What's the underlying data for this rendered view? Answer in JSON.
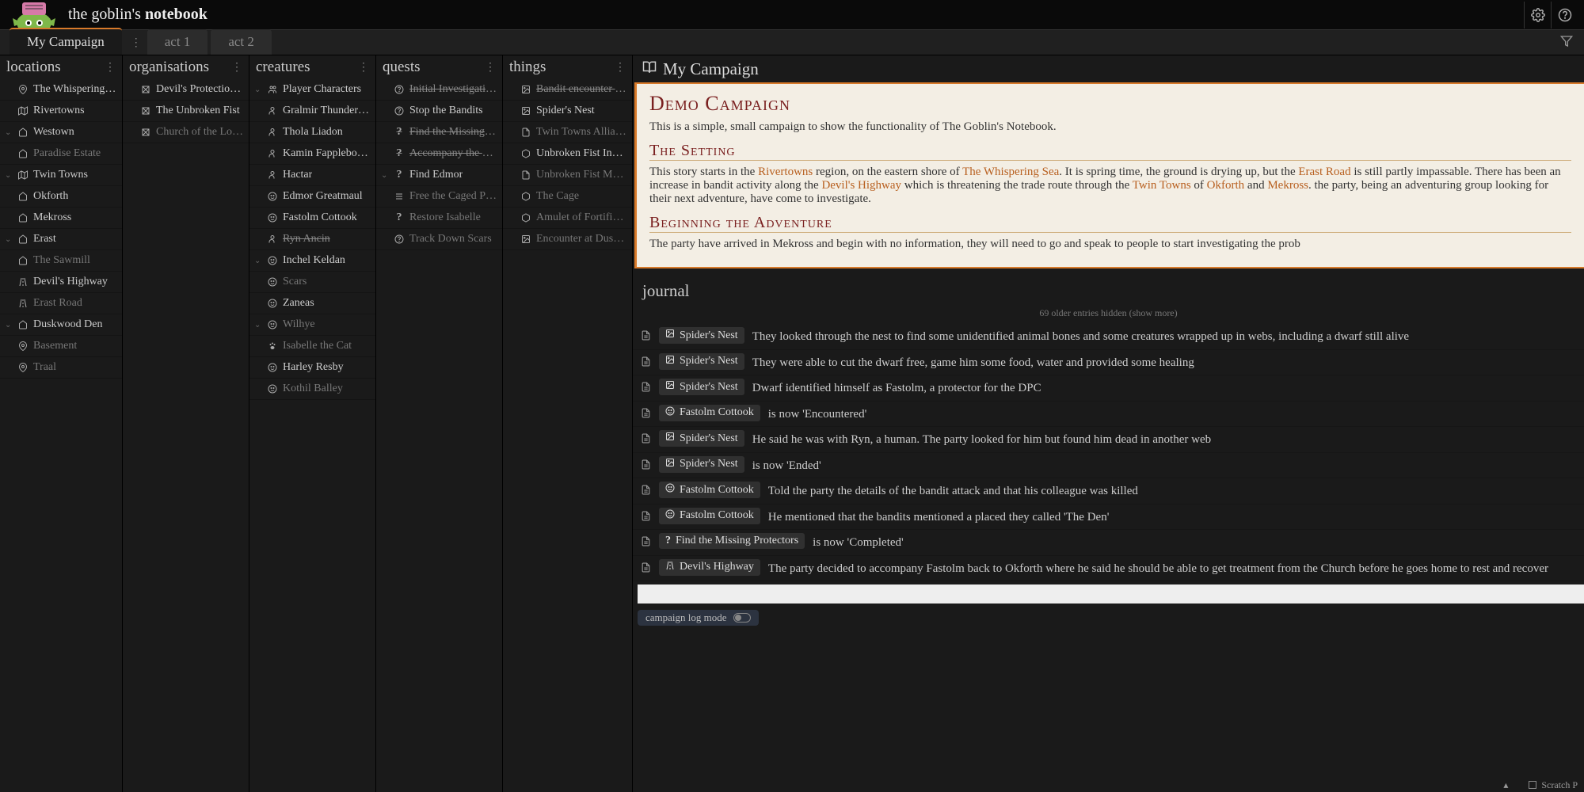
{
  "app": {
    "title_prefix": "the goblin's ",
    "title_bold": "notebook"
  },
  "tabs": {
    "active": "My Campaign",
    "others": [
      "act 1",
      "act 2"
    ]
  },
  "columns": {
    "locations": {
      "title": "locations",
      "items": [
        {
          "icon": "pin",
          "label": "The Whispering Sea",
          "indent": 0
        },
        {
          "icon": "map",
          "label": "Rivertowns",
          "indent": 0
        },
        {
          "icon": "home",
          "label": "Westown",
          "indent": 0,
          "chev": true
        },
        {
          "icon": "home",
          "label": "Paradise Estate",
          "indent": 1,
          "dim": true
        },
        {
          "icon": "map",
          "label": "Twin Towns",
          "indent": 0,
          "chev": true
        },
        {
          "icon": "home",
          "label": "Okforth",
          "indent": 1
        },
        {
          "icon": "home",
          "label": "Mekross",
          "indent": 1
        },
        {
          "icon": "home",
          "label": "Erast",
          "indent": 0,
          "chev": true
        },
        {
          "icon": "home",
          "label": "The Sawmill",
          "indent": 1,
          "dim": true
        },
        {
          "icon": "road",
          "label": "Devil's Highway",
          "indent": 0
        },
        {
          "icon": "road",
          "label": "Erast Road",
          "indent": 0,
          "dim": true
        },
        {
          "icon": "home",
          "label": "Duskwood Den",
          "indent": 0,
          "chev": true
        },
        {
          "icon": "pin",
          "label": "Basement",
          "indent": 1,
          "dim": true
        },
        {
          "icon": "pin",
          "label": "Traal",
          "indent": 0,
          "dim": true
        }
      ]
    },
    "organisations": {
      "title": "organisations",
      "items": [
        {
          "icon": "org",
          "label": "Devil's Protection C…",
          "indent": 0
        },
        {
          "icon": "org",
          "label": "The Unbroken Fist",
          "indent": 0
        },
        {
          "icon": "org",
          "label": "Church of the Long …",
          "indent": 0,
          "dim": true
        }
      ]
    },
    "creatures": {
      "title": "creatures",
      "items": [
        {
          "icon": "group",
          "label": "Player Characters",
          "indent": 0,
          "chev": true
        },
        {
          "icon": "person",
          "label": "Gralmir Thunderkeg",
          "indent": 1
        },
        {
          "icon": "person",
          "label": "Thola Liadon",
          "indent": 1
        },
        {
          "icon": "person",
          "label": "Kamin Fapplebott…",
          "indent": 1
        },
        {
          "icon": "person",
          "label": "Hactar",
          "indent": 1
        },
        {
          "icon": "face",
          "label": "Edmor Greatmaul",
          "indent": 0
        },
        {
          "icon": "face",
          "label": "Fastolm Cottook",
          "indent": 0
        },
        {
          "icon": "person",
          "label": "Ryn Ancin",
          "indent": 0,
          "dim": true,
          "strike": true
        },
        {
          "icon": "face",
          "label": "Inchel Keldan",
          "indent": 0,
          "chev": true
        },
        {
          "icon": "face",
          "label": "Scars",
          "indent": 1,
          "dim": true
        },
        {
          "icon": "face",
          "label": "Zaneas",
          "indent": 0
        },
        {
          "icon": "face",
          "label": "Wilhye",
          "indent": 0,
          "dim": true,
          "chev": true
        },
        {
          "icon": "paw",
          "label": "Isabelle the Cat",
          "indent": 1,
          "dim": true
        },
        {
          "icon": "face",
          "label": "Harley Resby",
          "indent": 0
        },
        {
          "icon": "face",
          "label": "Kothil Balley",
          "indent": 0,
          "dim": true
        }
      ]
    },
    "quests": {
      "title": "quests",
      "items": [
        {
          "icon": "quest",
          "label": "Initial Investigations",
          "indent": 0,
          "strike": true,
          "dim": true
        },
        {
          "icon": "quest",
          "label": "Stop the Bandits",
          "indent": 0
        },
        {
          "icon": "q",
          "label": "Find the Missing Pr…",
          "indent": 1,
          "strike": true,
          "dim": true
        },
        {
          "icon": "q",
          "label": "Accompany the Urg…",
          "indent": 1,
          "strike": true,
          "dim": true
        },
        {
          "icon": "q",
          "label": "Find Edmor",
          "indent": 0,
          "chev": true
        },
        {
          "icon": "list",
          "label": "Free the Caged Pri…",
          "indent": 1,
          "dim": true
        },
        {
          "icon": "q",
          "label": "Restore Isabelle",
          "indent": 1,
          "dim": true
        },
        {
          "icon": "quest",
          "label": "Track Down Scars",
          "indent": 0,
          "dim": true
        }
      ]
    },
    "things": {
      "title": "things",
      "items": [
        {
          "icon": "image",
          "label": "Bandit encounter al…",
          "indent": 0,
          "dim": true,
          "strike": true
        },
        {
          "icon": "image",
          "label": "Spider's Nest",
          "indent": 0
        },
        {
          "icon": "doc",
          "label": "Twin Towns Alliance…",
          "indent": 0,
          "dim": true
        },
        {
          "icon": "cube",
          "label": "Unbroken Fist Insignia",
          "indent": 0
        },
        {
          "icon": "doc",
          "label": "Unbroken Fist Motiv…",
          "indent": 0,
          "dim": true
        },
        {
          "icon": "cube",
          "label": "The Cage",
          "indent": 0,
          "dim": true
        },
        {
          "icon": "cube",
          "label": "Amulet of Fortificati…",
          "indent": 0,
          "dim": true
        },
        {
          "icon": "image",
          "label": "Encounter at Duskw…",
          "indent": 0,
          "dim": true
        }
      ]
    }
  },
  "content": {
    "header": "My Campaign",
    "doc_title": "Demo Campaign",
    "doc_intro": "This is a simple, small campaign to show the functionality of The Goblin's Notebook.",
    "setting_h": "The Setting",
    "setting_body_parts": [
      "This story starts in the ",
      {
        "link": "Rivertowns"
      },
      " region, on the eastern shore of ",
      {
        "link": "The Whispering Sea"
      },
      ". It is spring time, the ground is drying up, but the ",
      {
        "link": "Erast Road"
      },
      " is still partly impassable. There has been an increase in bandit activity along the ",
      {
        "link": "Devil's Highway"
      },
      " which is threatening the trade route through the ",
      {
        "link": "Twin Towns"
      },
      " of ",
      {
        "link": "Okforth"
      },
      " and ",
      {
        "link": "Mekross"
      },
      ". the party, being an adventuring group looking for their next adventure, have come to investigate."
    ],
    "begin_h": "Beginning the Adventure",
    "begin_body": "The party have arrived in Mekross and begin with no information, they will need to go and speak to people to start investigating the prob"
  },
  "journal": {
    "title": "journal",
    "hidden_text": "69 older entries hidden (show more)",
    "entries": [
      {
        "tag_icon": "image",
        "tag": "Spider's Nest",
        "text": "They looked through the nest to find some unidentified animal bones and some creatures wrapped up in webs, including a dwarf still alive"
      },
      {
        "tag_icon": "image",
        "tag": "Spider's Nest",
        "text": "They were able to cut the dwarf free, game him some food, water and provided some healing"
      },
      {
        "tag_icon": "image",
        "tag": "Spider's Nest",
        "text": "Dwarf identified himself as Fastolm, a protector for the DPC"
      },
      {
        "tag_icon": "face",
        "tag": "Fastolm Cottook",
        "text": "is now 'Encountered'"
      },
      {
        "tag_icon": "image",
        "tag": "Spider's Nest",
        "text": "He said he was with Ryn, a human. The party looked for him but found him dead in another web"
      },
      {
        "tag_icon": "image",
        "tag": "Spider's Nest",
        "text": "is now 'Ended'"
      },
      {
        "tag_icon": "face",
        "tag": "Fastolm Cottook",
        "text": "Told the party the details of the bandit attack and that his colleague was killed"
      },
      {
        "tag_icon": "face",
        "tag": "Fastolm Cottook",
        "text": "He mentioned that the bandits mentioned a placed they called 'The Den'"
      },
      {
        "tag_icon": "q",
        "tag": "Find the Missing Protectors",
        "text": "is now 'Completed'"
      },
      {
        "tag_icon": "road",
        "tag": "Devil's Highway",
        "text": "The party decided to accompany Fastolm back to Okforth where he said he should be able to get treatment from the Church before he goes home to rest and recover"
      }
    ],
    "log_mode_label": "campaign log mode"
  },
  "status": {
    "scratch": "Scratch P"
  }
}
